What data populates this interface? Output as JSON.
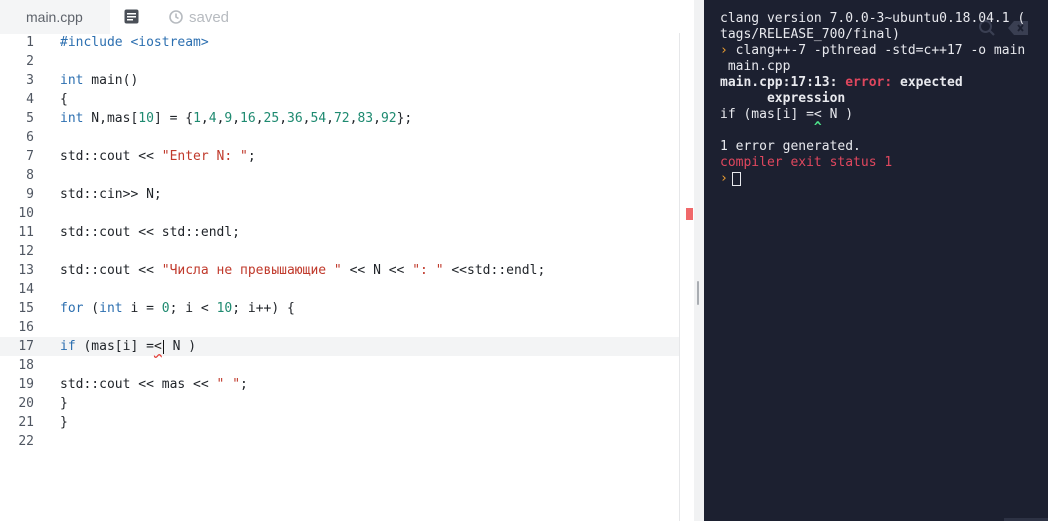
{
  "editor": {
    "tab_label": "main.cpp",
    "saved_label": "saved",
    "lines": [
      {
        "n": "1",
        "tokens": [
          {
            "t": "#include <iostream>",
            "c": "kw"
          }
        ]
      },
      {
        "n": "2",
        "tokens": []
      },
      {
        "n": "3",
        "tokens": [
          {
            "t": "int",
            "c": "kw"
          },
          {
            "t": " main()",
            "c": ""
          }
        ]
      },
      {
        "n": "4",
        "tokens": [
          {
            "t": "{",
            "c": ""
          }
        ]
      },
      {
        "n": "5",
        "tokens": [
          {
            "t": "int",
            "c": "kw"
          },
          {
            "t": " N,mas[",
            "c": ""
          },
          {
            "t": "10",
            "c": "num"
          },
          {
            "t": "] = {",
            "c": ""
          },
          {
            "t": "1",
            "c": "num"
          },
          {
            "t": ",",
            "c": ""
          },
          {
            "t": "4",
            "c": "num"
          },
          {
            "t": ",",
            "c": ""
          },
          {
            "t": "9",
            "c": "num"
          },
          {
            "t": ",",
            "c": ""
          },
          {
            "t": "16",
            "c": "num"
          },
          {
            "t": ",",
            "c": ""
          },
          {
            "t": "25",
            "c": "num"
          },
          {
            "t": ",",
            "c": ""
          },
          {
            "t": "36",
            "c": "num"
          },
          {
            "t": ",",
            "c": ""
          },
          {
            "t": "54",
            "c": "num"
          },
          {
            "t": ",",
            "c": ""
          },
          {
            "t": "72",
            "c": "num"
          },
          {
            "t": ",",
            "c": ""
          },
          {
            "t": "83",
            "c": "num"
          },
          {
            "t": ",",
            "c": ""
          },
          {
            "t": "92",
            "c": "num"
          },
          {
            "t": "};",
            "c": ""
          }
        ]
      },
      {
        "n": "6",
        "tokens": []
      },
      {
        "n": "7",
        "tokens": [
          {
            "t": "std::cout << ",
            "c": ""
          },
          {
            "t": "\"Enter N: \"",
            "c": "str"
          },
          {
            "t": ";",
            "c": ""
          }
        ]
      },
      {
        "n": "8",
        "tokens": []
      },
      {
        "n": "9",
        "tokens": [
          {
            "t": "std::cin>> N;",
            "c": ""
          }
        ]
      },
      {
        "n": "10",
        "tokens": []
      },
      {
        "n": "11",
        "tokens": [
          {
            "t": "std::cout << std::endl;",
            "c": ""
          }
        ]
      },
      {
        "n": "12",
        "tokens": []
      },
      {
        "n": "13",
        "tokens": [
          {
            "t": "std::cout << ",
            "c": ""
          },
          {
            "t": "\"Числа не превышающие \"",
            "c": "str"
          },
          {
            "t": " << N << ",
            "c": ""
          },
          {
            "t": "\": \"",
            "c": "str"
          },
          {
            "t": " <<std::endl;",
            "c": ""
          }
        ]
      },
      {
        "n": "14",
        "tokens": []
      },
      {
        "n": "15",
        "tokens": [
          {
            "t": "for",
            "c": "kw"
          },
          {
            "t": " (",
            "c": ""
          },
          {
            "t": "int",
            "c": "kw"
          },
          {
            "t": " i = ",
            "c": ""
          },
          {
            "t": "0",
            "c": "num"
          },
          {
            "t": "; i < ",
            "c": ""
          },
          {
            "t": "10",
            "c": "num"
          },
          {
            "t": "; i++) {",
            "c": ""
          }
        ]
      },
      {
        "n": "16",
        "tokens": []
      },
      {
        "n": "17",
        "current": true,
        "tokens": [
          {
            "t": "if",
            "c": "kw"
          },
          {
            "t": " (mas[i] =",
            "c": ""
          },
          {
            "t": "<",
            "c": "err"
          },
          {
            "t": "|",
            "c": "caret"
          },
          {
            "t": " N )",
            "c": ""
          }
        ]
      },
      {
        "n": "18",
        "tokens": []
      },
      {
        "n": "19",
        "tokens": [
          {
            "t": "std::cout << mas << ",
            "c": ""
          },
          {
            "t": "\" \"",
            "c": "str"
          },
          {
            "t": ";",
            "c": ""
          }
        ]
      },
      {
        "n": "20",
        "tokens": [
          {
            "t": "}",
            "c": ""
          }
        ]
      },
      {
        "n": "21",
        "tokens": [
          {
            "t": "}",
            "c": ""
          }
        ]
      },
      {
        "n": "22",
        "tokens": []
      }
    ]
  },
  "console": {
    "line1": "clang version 7.0.0-3~ubuntu0.18.04.1 (",
    "line2": "tags/RELEASE_700/final)",
    "cmd_prompt": "›",
    "cmd": " clang++-7 -pthread -std=c++17 -o main",
    "cmd_cont": " main.cpp",
    "err_loc": "main.cpp:17:13: ",
    "err_word": "error:",
    "err_msg": " expected",
    "err_msg2": "      expression",
    "src_line": "if (mas[i] =< N )",
    "caret_mark": "            ^",
    "summary": "1 error generated.",
    "exit_status": "compiler exit status 1",
    "final_prompt": "›"
  },
  "colors": {
    "console_bg": "#1c2030",
    "error_red": "#e0475e",
    "keyword_blue": "#2c6fb0",
    "string_red": "#c0392b",
    "number_teal": "#1e8a70",
    "prompt_orange": "#f0a030"
  }
}
